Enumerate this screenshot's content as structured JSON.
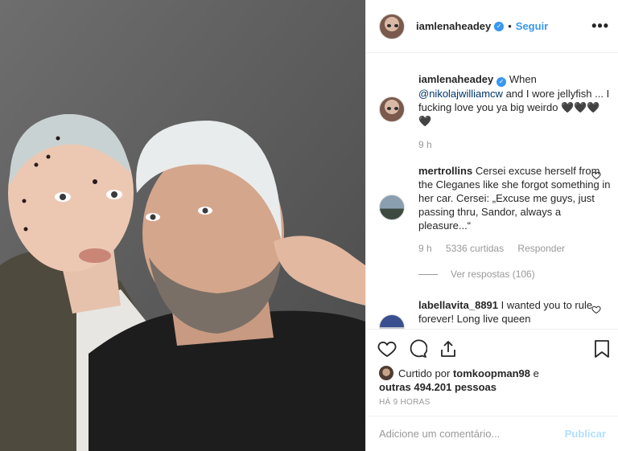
{
  "post": {
    "image_alt": "selfie photo",
    "colors": {
      "accent": "#3897f0",
      "muted": "#999999",
      "publish_disabled": "#b2dffc"
    }
  },
  "header": {
    "username": "iamlenaheadey",
    "separator": "•",
    "follow_label": "Seguir",
    "more_icon": "more-horizontal-icon",
    "more_glyph": "•••"
  },
  "caption": {
    "username": "iamlenaheadey",
    "text_before": "When",
    "mention": "@nikolajwilliamcw",
    "text_after": "and I wore jellyfish ... I fucking love you ya big weirdo 🖤🖤🖤🖤",
    "time": "9 h"
  },
  "comments": [
    {
      "username": "mertrollins",
      "text": "Cersei excuse herself from the Cleganes like she forgot something in her car. Cersei: „Excuse me guys, just passing thru, Sandor, always a pleasure...“",
      "time": "9 h",
      "likes": "5336 curtidas",
      "reply_label": "Responder",
      "view_replies": "Ver respostas (106)"
    },
    {
      "username": "labellavita_8891",
      "text": "I wanted you to rule forever! Long live queen"
    }
  ],
  "actions": {
    "like_icon": "heart-icon",
    "comment_icon": "comment-icon",
    "share_icon": "share-icon",
    "save_icon": "bookmark-icon"
  },
  "likes": {
    "prefix": "Curtido por",
    "user": "tomkoopman98",
    "middle": "e",
    "others": "outras 494.201 pessoas"
  },
  "timestamp": "HÁ 9 HORAS",
  "add_comment": {
    "placeholder": "Adicione um comentário...",
    "publish_label": "Publicar"
  }
}
